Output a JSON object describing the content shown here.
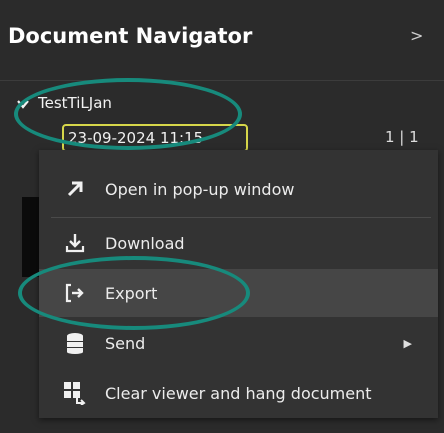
{
  "header": {
    "title": "Document Navigator",
    "collapse_icon": "chevron-right-icon"
  },
  "tree": {
    "item_label": "TestTiLJan",
    "expand_icon": "chevron-down-icon",
    "date_value": "23-09-2024 11:15",
    "page_count": "1 | 1"
  },
  "context_menu": {
    "items": [
      {
        "label": "Open in pop-up window",
        "icon": "arrow-up-right-icon"
      },
      {
        "label": "Download",
        "icon": "download-icon"
      },
      {
        "label": "Export",
        "icon": "export-icon"
      },
      {
        "label": "Send",
        "icon": "database-send-icon",
        "has_submenu": true
      },
      {
        "label": "Clear viewer and hang document",
        "icon": "grid-hang-icon"
      }
    ]
  },
  "colors": {
    "annotation": "#178a7c",
    "date_highlight": "#d6d64a",
    "menu_bg": "#333333",
    "menu_hover": "#464646"
  }
}
